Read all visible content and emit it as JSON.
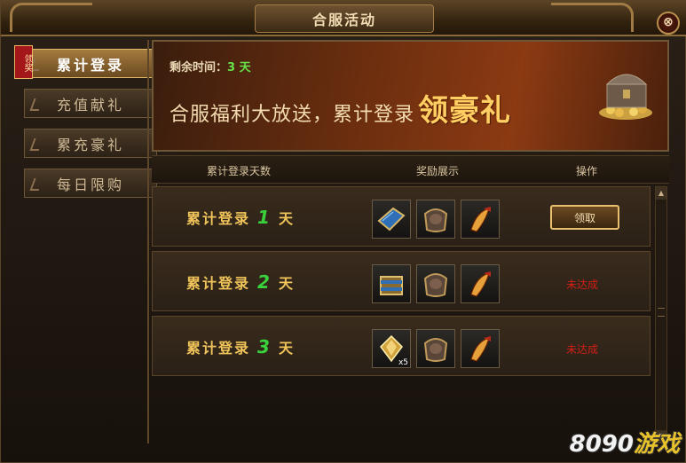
{
  "window": {
    "title": "合服活动",
    "close_label": "⊗"
  },
  "sidebar": {
    "ribbon_text": "领奖",
    "items": [
      {
        "label": "累计登录",
        "active": true
      },
      {
        "label": "充值献礼",
        "active": false
      },
      {
        "label": "累充豪礼",
        "active": false
      },
      {
        "label": "每日限购",
        "active": false
      }
    ]
  },
  "banner": {
    "remaining_label": "剩余时间：",
    "remaining_value": "3 天",
    "headline": "合服福利大放送，累计登录",
    "headline_big": "领豪礼"
  },
  "table": {
    "headers": [
      "累计登录天数",
      "奖励展示",
      "操作"
    ],
    "rows": [
      {
        "prefix": "累计登录",
        "day": "1",
        "suffix": "天",
        "action": "领取",
        "status": ""
      },
      {
        "prefix": "累计登录",
        "day": "2",
        "suffix": "天",
        "action": "",
        "status": "未达成"
      },
      {
        "prefix": "累计登录",
        "day": "3",
        "suffix": "天",
        "action": "",
        "status": "未达成"
      }
    ],
    "row3_item_qty": "x5"
  },
  "watermark": {
    "num": "8090",
    "text": "游戏"
  },
  "colors": {
    "accent": "#ffcf63",
    "day_num": "#39d23c",
    "status_red": "#d11d15"
  }
}
